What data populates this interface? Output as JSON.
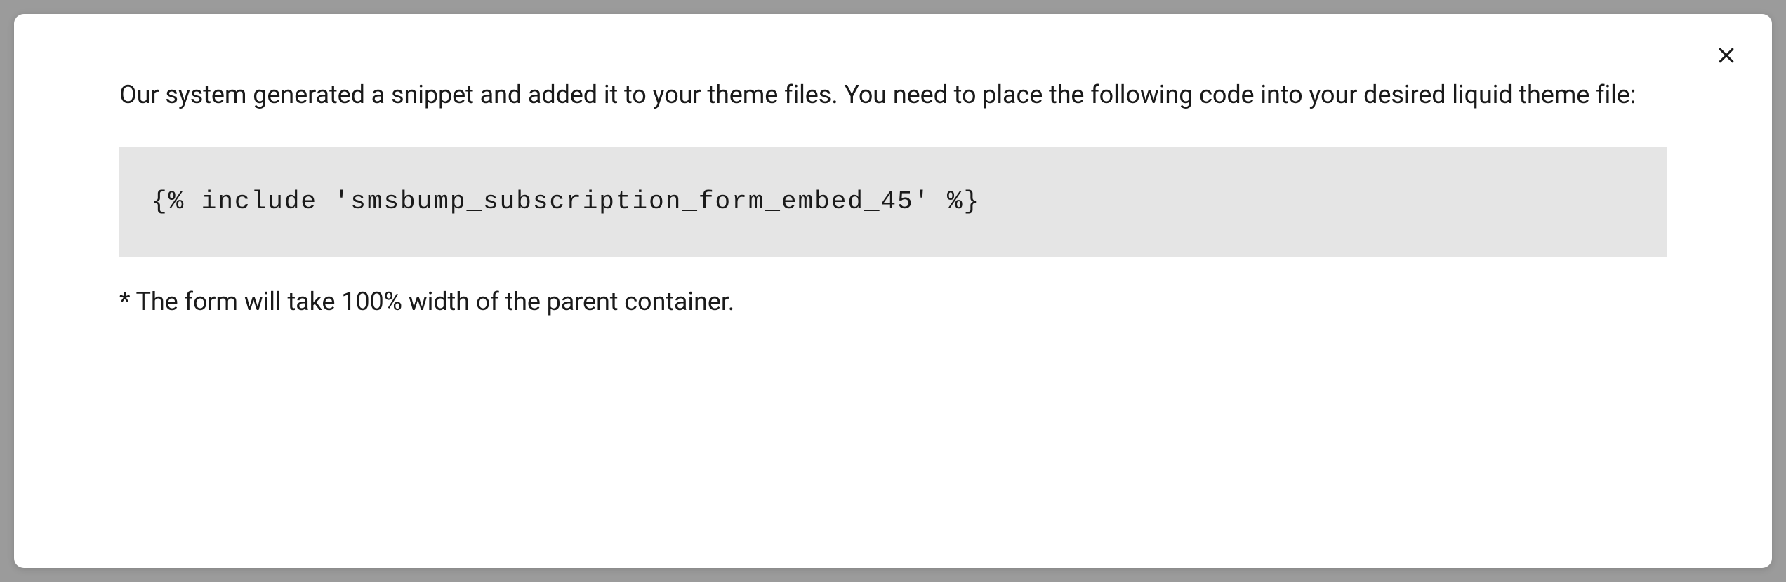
{
  "modal": {
    "intro": "Our system generated a snippet and added it to your theme files. You need to place the following code into your desired liquid theme file:",
    "code": "{% include 'smsbump_subscription_form_embed_45' %}",
    "note": "* The form will take 100% width of the parent container."
  }
}
